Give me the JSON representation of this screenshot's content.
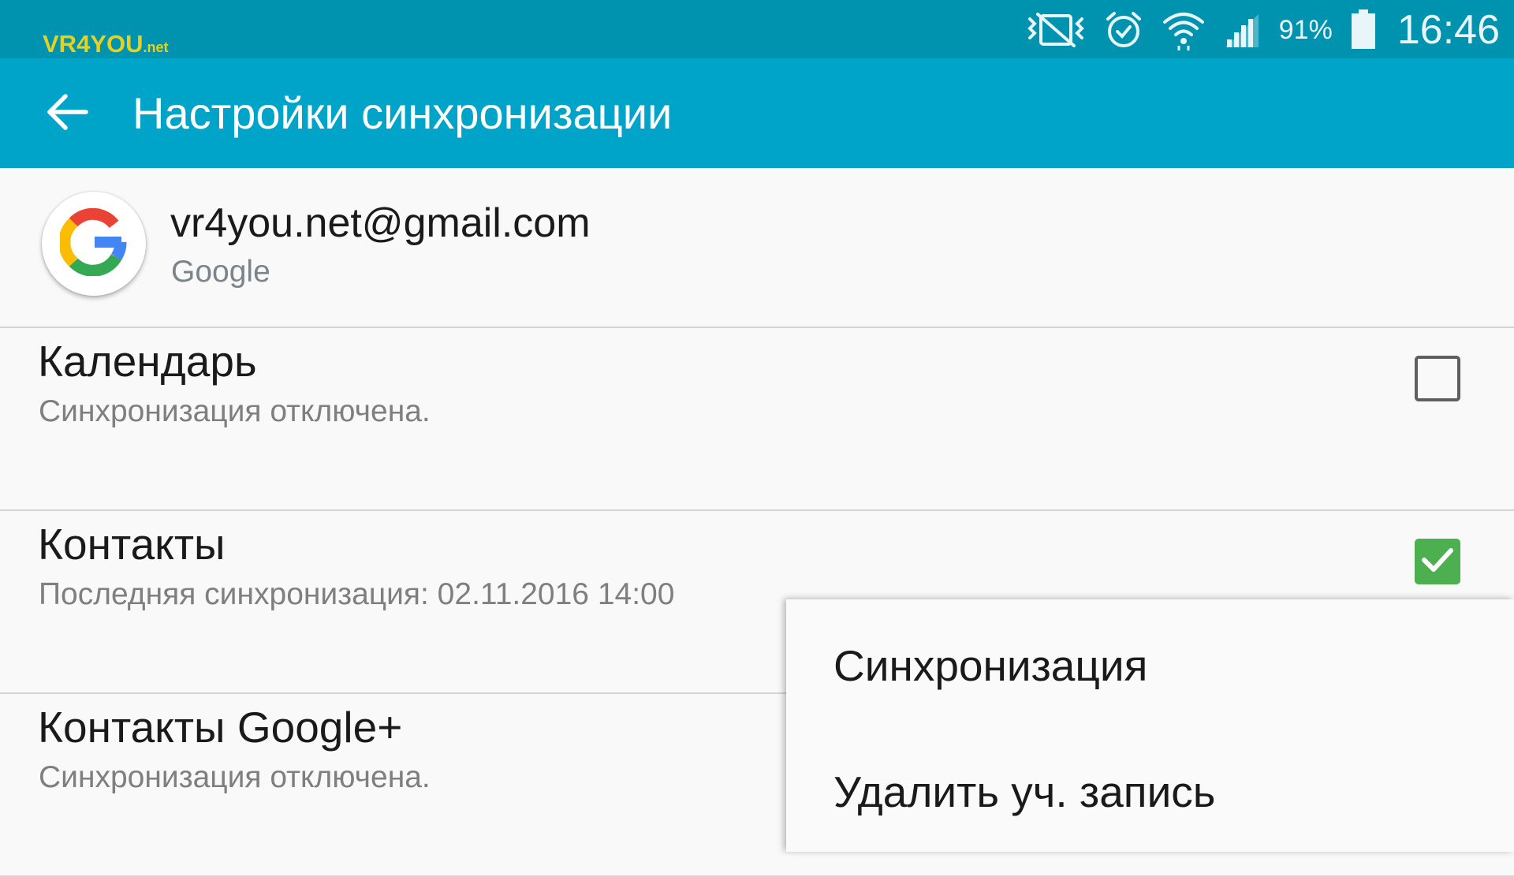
{
  "watermark": {
    "main": "VR4YOU",
    "suffix": ".net"
  },
  "status_bar": {
    "icons": [
      "vibrate-mute-icon",
      "alarm-icon",
      "wifi-icon",
      "signal-icon",
      "battery-icon"
    ],
    "battery_percent": "91%",
    "battery_level": 0.91,
    "time": "16:46"
  },
  "app_bar": {
    "back_icon": "arrow-back-icon",
    "title": "Настройки синхронизации"
  },
  "account": {
    "email": "vr4you.net@gmail.com",
    "type": "Google",
    "icon": "google-logo-icon"
  },
  "sync_items": [
    {
      "title": "Календарь",
      "subtitle": "Синхронизация отключена.",
      "checked": false
    },
    {
      "title": "Контакты",
      "subtitle": "Последняя синхронизация: 02.11.2016 14:00",
      "checked": true
    },
    {
      "title": "Контакты Google+",
      "subtitle": "Синхронизация отключена.",
      "checked": false
    }
  ],
  "menu": {
    "items": [
      "Синхронизация",
      "Удалить уч. запись"
    ]
  },
  "colors": {
    "status_bar": "#0093b0",
    "app_bar": "#00a4c9",
    "checkbox_on": "#4caf50",
    "background": "#f9f9f9"
  }
}
